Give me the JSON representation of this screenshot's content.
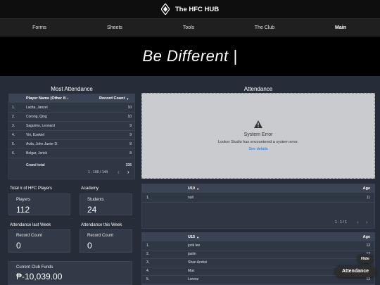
{
  "header": {
    "title": "The HFC HUB",
    "logo_icon": "diamond-crest-icon"
  },
  "nav": {
    "items": [
      "Forms",
      "Sheets",
      "Tools",
      "The Club",
      "Main"
    ],
    "active": "Main"
  },
  "hero": {
    "tagline": "Be Different |"
  },
  "most_attendance": {
    "title": "Most Attendance",
    "col_player": "Player Name (Other if...",
    "col_count": "Record Count",
    "rows": [
      {
        "n": "1.",
        "name": "Lacita, Janzel",
        "count": "10"
      },
      {
        "n": "2.",
        "name": "Corong, Qing",
        "count": "10"
      },
      {
        "n": "3.",
        "name": "Saguimo, Leonard",
        "count": "9"
      },
      {
        "n": "4.",
        "name": "Viri, Ezekiel",
        "count": "9"
      },
      {
        "n": "5.",
        "name": "Avila, John Javier D.",
        "count": "8"
      },
      {
        "n": "6.",
        "name": "Belgar, Jorick",
        "count": "8"
      }
    ],
    "grand_total_label": "Grand total",
    "grand_total": "335",
    "pagination": "1 - 100 / 144"
  },
  "attendance": {
    "title": "Attendance",
    "error_title": "System Error",
    "error_msg": "Looker Studio has encountered a system error.",
    "error_link": "See details"
  },
  "stats": {
    "total_players_title": "Total # of HFC Players",
    "players_label": "Players",
    "players_value": "112",
    "academy_title": "Academy",
    "students_label": "Students",
    "students_value": "24",
    "last_week_title": "Attendance last Week",
    "last_week_label": "Record Count",
    "last_week_value": "0",
    "this_week_title": "Attendance this Week",
    "this_week_label": "Record Count",
    "this_week_value": "0",
    "funds_label": "Current Club Funds",
    "funds_value": "₱-10,039.00"
  },
  "u10": {
    "col_group": "U10",
    "col_age": "Age",
    "rows": [
      {
        "n": "1.",
        "name": "null",
        "age": "11"
      }
    ],
    "pagination": "1 - 1 / 1"
  },
  "u15": {
    "col_group": "U15",
    "col_age": "Age",
    "rows": [
      {
        "n": "1.",
        "name": "jorik lee",
        "age": "13"
      },
      {
        "n": "2.",
        "name": "jastin",
        "age": "13"
      },
      {
        "n": "3.",
        "name": "Shan Andrei",
        "age": "13"
      },
      {
        "n": "4.",
        "name": "Max",
        "age": "13"
      },
      {
        "n": "5.",
        "name": "Lorenz",
        "age": "13"
      }
    ]
  },
  "floating": {
    "hide_label": "Hide",
    "attendance_label": "Attendance"
  }
}
